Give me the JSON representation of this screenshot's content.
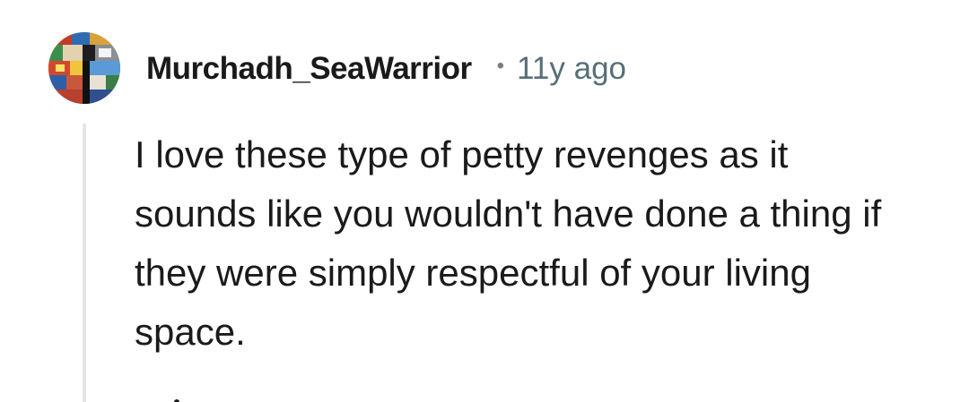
{
  "comment": {
    "avatar_icon": "user-avatar-icon",
    "username": "Murchadh_SeaWarrior",
    "separator": "•",
    "timestamp": "11y ago",
    "body": "I love these type of petty revenges as it sounds like you wouldn't have done a thing if they were simply respectful of your living space."
  },
  "colors": {
    "username": "#1a1a1b",
    "timestamp": "#576f76",
    "thread_line": "#e6e6e6",
    "background": "#ffffff"
  }
}
